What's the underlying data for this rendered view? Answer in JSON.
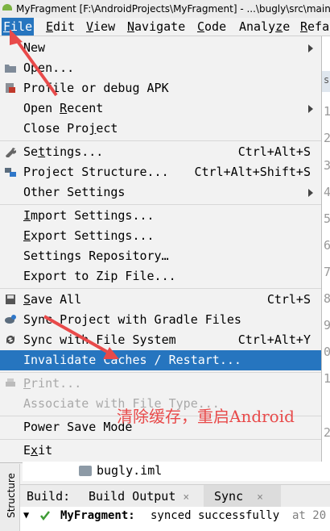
{
  "titlebar": {
    "text": "MyFragment [F:\\AndroidProjects\\MyFragment] - ...\\bugly\\src\\main\\"
  },
  "menubar": [
    {
      "label": "File",
      "mn": "F",
      "rest": "ile"
    },
    {
      "label": "Edit",
      "mn": "E",
      "rest": "dit"
    },
    {
      "label": "View",
      "mn": "V",
      "rest": "iew"
    },
    {
      "label": "Navigate",
      "mn": "N",
      "rest": "avigate"
    },
    {
      "label": "Code",
      "mn": "C",
      "rest": "ode"
    },
    {
      "label": "Analyze",
      "mn": "z",
      "rest": ""
    },
    {
      "label": "Refa",
      "mn": "R",
      "rest": "efa"
    }
  ],
  "file_menu": {
    "new": "New",
    "open": "Open...",
    "profile": "Profile or debug APK",
    "open_recent": "Open Recent",
    "close_project": "Close Project",
    "settings": "Settings...",
    "settings_sc": "Ctrl+Alt+S",
    "project_structure": "Project Structure...",
    "project_structure_sc": "Ctrl+Alt+Shift+S",
    "other_settings": "Other Settings",
    "import_settings": "Import Settings...",
    "export_settings": "Export Settings...",
    "settings_repository": "Settings Repository…",
    "export_zip": "Export to Zip File...",
    "save_all": "Save All",
    "save_all_sc": "Ctrl+S",
    "sync_gradle": "Sync Project with Gradle Files",
    "sync_fs": "Sync with File System",
    "sync_fs_sc": "Ctrl+Alt+Y",
    "invalidate": "Invalidate Caches / Restart...",
    "print": "Print...",
    "associate": "Associate with File Type...",
    "power_save": "Power Save Mode",
    "exit": "Exit"
  },
  "gutter": [
    "s",
    "1",
    "2",
    "3",
    "4",
    "5",
    "6",
    "7",
    "8",
    "9",
    "0",
    "1",
    "2"
  ],
  "annotation": "清除缓存，重启Android",
  "project_tree": {
    "file": "bugly.iml"
  },
  "tool_windows": {
    "structure": "Structure"
  },
  "build_panel": {
    "build_label": "Build:",
    "tab_build_output": "Build Output",
    "tab_sync": "Sync",
    "close_glyph": "×",
    "row_project": "MyFragment:",
    "row_status": "synced successfully",
    "row_at": "at 20"
  },
  "colors": {
    "accent": "#2675bf",
    "annotation_red": "#e84a4a"
  }
}
